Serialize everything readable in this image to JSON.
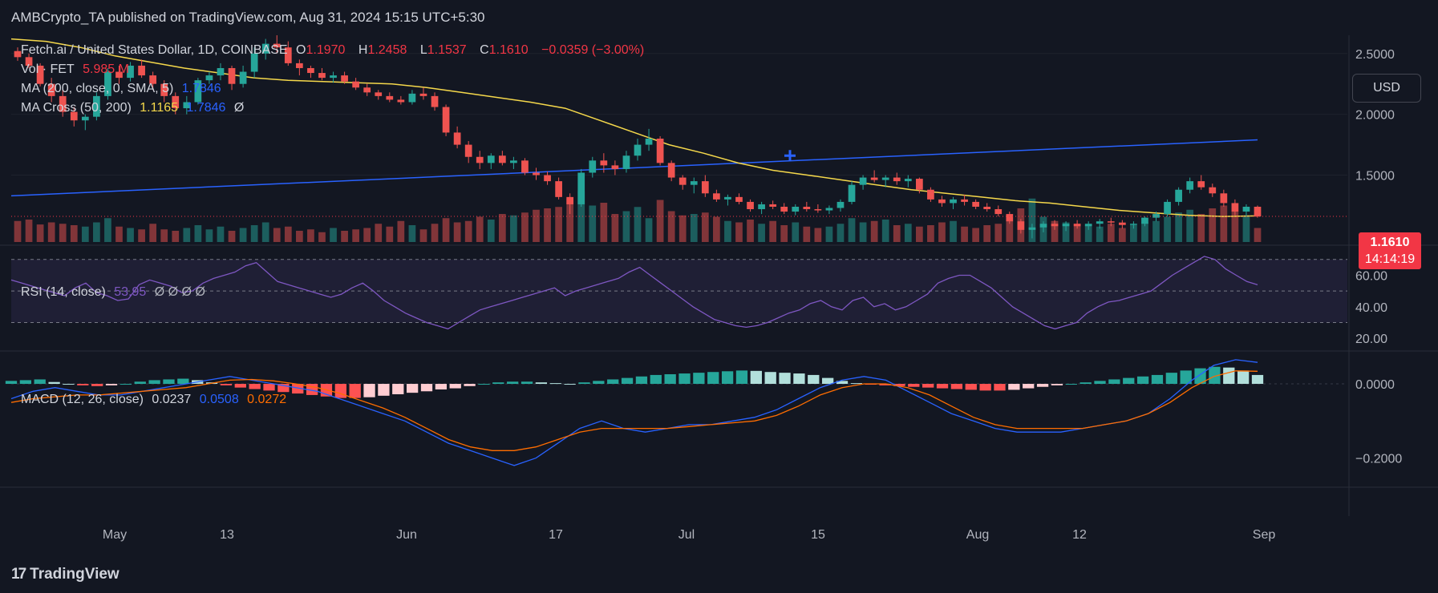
{
  "header": {
    "published": "AMBCrypto_TA published on TradingView.com, Aug 31, 2024 15:15 UTC+5:30"
  },
  "footer": {
    "brand": "TradingView",
    "logo_mark": "17"
  },
  "currency_button": "USD",
  "price_tag": {
    "price": "1.1610",
    "countdown": "14:14:19",
    "color": "#f23645"
  },
  "legend": {
    "symbol": "Fetch.ai / United States Dollar, 1D, COINBASE",
    "open_label": "O",
    "open": "1.1970",
    "high_label": "H",
    "high": "1.2458",
    "low_label": "L",
    "low": "1.1537",
    "close_label": "C",
    "close": "1.1610",
    "change": "−0.0359 (−3.00%)",
    "vol_label": "Vol · FET",
    "vol_value": "5.985 M",
    "ma_label": "MA (200, close, 0, SMA, 5)",
    "ma_value": "1.7846",
    "mac_label": "MA Cross (50, 200)",
    "mac_fast": "1.1165",
    "mac_slow": "1.7846",
    "mac_extra": "Ø",
    "rsi_label": "RSI (14, close)",
    "rsi_value": "53.95",
    "rsi_extra": "Ø Ø Ø Ø",
    "macd_label": "MACD (12, 26, close)",
    "macd_value": "0.0237",
    "signal_value": "0.0508",
    "hist_value": "0.0272"
  },
  "colors": {
    "up": "#26a69a",
    "down": "#ef5350",
    "ma200": "#2962ff",
    "ma50": "#f5d84b",
    "rsi": "#7e57c2",
    "macd": "#2962ff",
    "signal": "#ff6d00",
    "bg": "#131722",
    "text": "#d1d4dc"
  },
  "chart_data": {
    "type": "candlestick",
    "x_ticks": [
      "May",
      "13",
      "Jun",
      "17",
      "Jul",
      "15",
      "Aug",
      "12",
      "Sep"
    ],
    "price_axis": {
      "ticks": [
        "2.5000",
        "2.0000",
        "1.5000"
      ],
      "ylim": [
        0.95,
        2.65
      ]
    },
    "rsi_axis": {
      "ticks": [
        "60.00",
        "40.00",
        "20.00"
      ],
      "ylim": [
        15,
        76
      ],
      "bands": [
        30,
        50,
        70
      ]
    },
    "macd_axis": {
      "ticks": [
        "0.0000",
        "−0.2000"
      ],
      "ylim": [
        -0.27,
        0.08
      ]
    },
    "candles": [
      [
        2.52,
        2.55,
        2.44,
        2.47
      ],
      [
        2.47,
        2.5,
        2.38,
        2.4
      ],
      [
        2.4,
        2.42,
        2.23,
        2.25
      ],
      [
        2.25,
        2.3,
        2.1,
        2.15
      ],
      [
        2.15,
        2.2,
        1.98,
        2.02
      ],
      [
        2.02,
        2.06,
        1.9,
        1.95
      ],
      [
        1.95,
        2.0,
        1.87,
        1.98
      ],
      [
        1.98,
        2.18,
        1.95,
        2.15
      ],
      [
        2.15,
        2.38,
        2.12,
        2.35
      ],
      [
        2.35,
        2.4,
        2.25,
        2.3
      ],
      [
        2.3,
        2.43,
        2.27,
        2.4
      ],
      [
        2.4,
        2.45,
        2.3,
        2.32
      ],
      [
        2.32,
        2.35,
        2.2,
        2.25
      ],
      [
        2.25,
        2.28,
        2.1,
        2.15
      ],
      [
        2.15,
        2.18,
        2.0,
        2.05
      ],
      [
        2.05,
        2.15,
        2.0,
        2.1
      ],
      [
        2.1,
        2.3,
        2.08,
        2.28
      ],
      [
        2.28,
        2.35,
        2.25,
        2.32
      ],
      [
        2.32,
        2.42,
        2.28,
        2.38
      ],
      [
        2.38,
        2.4,
        2.2,
        2.25
      ],
      [
        2.25,
        2.4,
        2.22,
        2.35
      ],
      [
        2.35,
        2.55,
        2.3,
        2.5
      ],
      [
        2.5,
        2.62,
        2.45,
        2.58
      ],
      [
        2.58,
        2.68,
        2.5,
        2.55
      ],
      [
        2.55,
        2.6,
        2.4,
        2.42
      ],
      [
        2.42,
        2.45,
        2.32,
        2.38
      ],
      [
        2.38,
        2.4,
        2.3,
        2.34
      ],
      [
        2.34,
        2.38,
        2.28,
        2.3
      ],
      [
        2.3,
        2.35,
        2.26,
        2.32
      ],
      [
        2.32,
        2.35,
        2.25,
        2.27
      ],
      [
        2.27,
        2.3,
        2.2,
        2.22
      ],
      [
        2.22,
        2.25,
        2.15,
        2.18
      ],
      [
        2.18,
        2.2,
        2.12,
        2.15
      ],
      [
        2.15,
        2.18,
        2.1,
        2.12
      ],
      [
        2.12,
        2.15,
        2.08,
        2.1
      ],
      [
        2.1,
        2.2,
        2.08,
        2.17
      ],
      [
        2.17,
        2.22,
        2.12,
        2.15
      ],
      [
        2.15,
        2.18,
        2.03,
        2.06
      ],
      [
        2.06,
        2.08,
        1.82,
        1.85
      ],
      [
        1.85,
        1.9,
        1.72,
        1.75
      ],
      [
        1.75,
        1.78,
        1.6,
        1.65
      ],
      [
        1.65,
        1.7,
        1.55,
        1.6
      ],
      [
        1.6,
        1.68,
        1.55,
        1.66
      ],
      [
        1.66,
        1.7,
        1.58,
        1.6
      ],
      [
        1.6,
        1.65,
        1.55,
        1.62
      ],
      [
        1.62,
        1.64,
        1.5,
        1.52
      ],
      [
        1.52,
        1.56,
        1.46,
        1.5
      ],
      [
        1.5,
        1.53,
        1.42,
        1.45
      ],
      [
        1.45,
        1.48,
        1.3,
        1.32
      ],
      [
        1.32,
        1.35,
        1.18,
        1.26
      ],
      [
        1.26,
        1.55,
        1.24,
        1.52
      ],
      [
        1.52,
        1.65,
        1.48,
        1.62
      ],
      [
        1.62,
        1.68,
        1.52,
        1.58
      ],
      [
        1.58,
        1.62,
        1.5,
        1.55
      ],
      [
        1.55,
        1.7,
        1.52,
        1.66
      ],
      [
        1.66,
        1.8,
        1.62,
        1.75
      ],
      [
        1.75,
        1.88,
        1.7,
        1.8
      ],
      [
        1.8,
        1.82,
        1.58,
        1.6
      ],
      [
        1.6,
        1.62,
        1.45,
        1.48
      ],
      [
        1.48,
        1.5,
        1.38,
        1.42
      ],
      [
        1.42,
        1.48,
        1.35,
        1.45
      ],
      [
        1.45,
        1.5,
        1.32,
        1.35
      ],
      [
        1.35,
        1.38,
        1.28,
        1.3
      ],
      [
        1.3,
        1.34,
        1.25,
        1.32
      ],
      [
        1.32,
        1.35,
        1.26,
        1.28
      ],
      [
        1.28,
        1.3,
        1.2,
        1.22
      ],
      [
        1.22,
        1.28,
        1.18,
        1.26
      ],
      [
        1.26,
        1.29,
        1.22,
        1.24
      ],
      [
        1.24,
        1.27,
        1.18,
        1.2
      ],
      [
        1.2,
        1.26,
        1.17,
        1.24
      ],
      [
        1.24,
        1.28,
        1.2,
        1.22
      ],
      [
        1.22,
        1.26,
        1.19,
        1.21
      ],
      [
        1.21,
        1.25,
        1.18,
        1.23
      ],
      [
        1.23,
        1.3,
        1.2,
        1.28
      ],
      [
        1.28,
        1.45,
        1.26,
        1.42
      ],
      [
        1.42,
        1.5,
        1.38,
        1.48
      ],
      [
        1.48,
        1.54,
        1.44,
        1.46
      ],
      [
        1.46,
        1.5,
        1.4,
        1.48
      ],
      [
        1.48,
        1.52,
        1.42,
        1.45
      ],
      [
        1.45,
        1.5,
        1.4,
        1.47
      ],
      [
        1.47,
        1.48,
        1.35,
        1.38
      ],
      [
        1.38,
        1.4,
        1.28,
        1.3
      ],
      [
        1.3,
        1.33,
        1.24,
        1.27
      ],
      [
        1.27,
        1.32,
        1.22,
        1.3
      ],
      [
        1.3,
        1.34,
        1.25,
        1.28
      ],
      [
        1.28,
        1.3,
        1.22,
        1.24
      ],
      [
        1.24,
        1.27,
        1.2,
        1.22
      ],
      [
        1.22,
        1.25,
        1.16,
        1.18
      ],
      [
        1.18,
        1.2,
        1.1,
        1.12
      ],
      [
        1.12,
        1.14,
        1.02,
        1.05
      ],
      [
        1.05,
        1.1,
        0.98,
        1.07
      ],
      [
        1.07,
        1.12,
        1.03,
        1.1
      ],
      [
        1.1,
        1.13,
        1.05,
        1.08
      ],
      [
        1.08,
        1.12,
        1.04,
        1.1
      ],
      [
        1.1,
        1.13,
        1.06,
        1.08
      ],
      [
        1.08,
        1.12,
        1.05,
        1.1
      ],
      [
        1.1,
        1.14,
        1.06,
        1.12
      ],
      [
        1.12,
        1.15,
        1.08,
        1.11
      ],
      [
        1.11,
        1.13,
        1.06,
        1.09
      ],
      [
        1.09,
        1.12,
        1.06,
        1.1
      ],
      [
        1.1,
        1.16,
        1.08,
        1.15
      ],
      [
        1.15,
        1.2,
        1.12,
        1.18
      ],
      [
        1.18,
        1.3,
        1.16,
        1.28
      ],
      [
        1.28,
        1.4,
        1.25,
        1.38
      ],
      [
        1.38,
        1.48,
        1.35,
        1.45
      ],
      [
        1.45,
        1.5,
        1.38,
        1.4
      ],
      [
        1.4,
        1.43,
        1.32,
        1.35
      ],
      [
        1.35,
        1.38,
        1.24,
        1.27
      ],
      [
        1.27,
        1.3,
        1.17,
        1.2
      ],
      [
        1.2,
        1.26,
        1.16,
        1.24
      ],
      [
        1.24,
        1.25,
        1.15,
        1.16
      ]
    ],
    "volume": [
      30,
      32,
      25,
      28,
      26,
      24,
      22,
      28,
      34,
      22,
      20,
      18,
      26,
      18,
      16,
      20,
      24,
      18,
      22,
      16,
      20,
      24,
      28,
      20,
      22,
      16,
      18,
      14,
      20,
      16,
      18,
      20,
      26,
      22,
      30,
      24,
      18,
      26,
      34,
      28,
      30,
      36,
      32,
      40,
      38,
      42,
      46,
      48,
      50,
      62,
      72,
      52,
      56,
      40,
      44,
      50,
      34,
      60,
      44,
      38,
      40,
      42,
      36,
      30,
      28,
      32,
      26,
      30,
      24,
      28,
      22,
      20,
      22,
      26,
      34,
      28,
      30,
      32,
      24,
      26,
      22,
      24,
      28,
      30,
      22,
      20,
      24,
      26,
      30,
      48,
      62,
      36,
      30,
      28,
      26,
      24,
      22,
      26,
      20,
      24,
      28,
      30,
      36,
      42,
      46,
      40,
      48,
      52,
      44,
      38,
      20
    ],
    "ma200": [
      1.33,
      1.79
    ],
    "ma50": [
      2.62,
      2.6,
      2.55,
      2.48,
      2.43,
      2.38,
      2.34,
      2.3,
      2.28,
      2.27,
      2.26,
      2.25,
      2.22,
      2.18,
      2.14,
      2.1,
      2.05,
      1.95,
      1.85,
      1.75,
      1.68,
      1.6,
      1.54,
      1.5,
      1.46,
      1.42,
      1.38,
      1.35,
      1.32,
      1.29,
      1.27,
      1.24,
      1.21,
      1.19,
      1.17,
      1.16,
      1.165
    ],
    "rsi": [
      57,
      55,
      53,
      51,
      49,
      47,
      52,
      55,
      49,
      47,
      44,
      45,
      54,
      57,
      55,
      53,
      49,
      50,
      55,
      58,
      60,
      62,
      66,
      68,
      62,
      56,
      54,
      52,
      50,
      48,
      46,
      48,
      52,
      55,
      50,
      44,
      40,
      36,
      33,
      30,
      28,
      26,
      30,
      34,
      38,
      40,
      42,
      44,
      46,
      48,
      50,
      52,
      47,
      50,
      52,
      54,
      56,
      58,
      62,
      65,
      60,
      55,
      50,
      45,
      40,
      36,
      32,
      30,
      28,
      27,
      28,
      30,
      33,
      36,
      38,
      42,
      44,
      40,
      38,
      44,
      46,
      40,
      42,
      38,
      40,
      44,
      48,
      55,
      58,
      60,
      60,
      56,
      52,
      46,
      40,
      36,
      32,
      28,
      26,
      28,
      30,
      36,
      40,
      43,
      44,
      46,
      48,
      50,
      55,
      60,
      64,
      68,
      72,
      70,
      64,
      60,
      56,
      53.95
    ],
    "macd": [
      -0.04,
      -0.02,
      -0.01,
      -0.02,
      -0.03,
      -0.03,
      -0.02,
      -0.01,
      0.0,
      0.01,
      0.02,
      0.01,
      0.0,
      -0.01,
      -0.02,
      -0.04,
      -0.06,
      -0.08,
      -0.1,
      -0.13,
      -0.16,
      -0.18,
      -0.2,
      -0.22,
      -0.2,
      -0.16,
      -0.12,
      -0.1,
      -0.12,
      -0.13,
      -0.12,
      -0.11,
      -0.11,
      -0.1,
      -0.09,
      -0.07,
      -0.04,
      -0.01,
      0.01,
      0.02,
      0.01,
      -0.02,
      -0.05,
      -0.08,
      -0.1,
      -0.12,
      -0.13,
      -0.13,
      -0.13,
      -0.12,
      -0.11,
      -0.1,
      -0.08,
      -0.04,
      0.01,
      0.05,
      0.065,
      0.058
    ],
    "signal": [
      -0.05,
      -0.04,
      -0.035,
      -0.03,
      -0.03,
      -0.025,
      -0.02,
      -0.015,
      -0.01,
      0.0,
      0.01,
      0.012,
      0.008,
      0.0,
      -0.01,
      -0.025,
      -0.045,
      -0.065,
      -0.09,
      -0.12,
      -0.15,
      -0.17,
      -0.18,
      -0.18,
      -0.17,
      -0.15,
      -0.13,
      -0.12,
      -0.12,
      -0.12,
      -0.12,
      -0.115,
      -0.11,
      -0.105,
      -0.1,
      -0.085,
      -0.06,
      -0.03,
      -0.01,
      0.0,
      0.0,
      -0.01,
      -0.03,
      -0.06,
      -0.09,
      -0.11,
      -0.12,
      -0.12,
      -0.12,
      -0.12,
      -0.11,
      -0.1,
      -0.08,
      -0.05,
      -0.01,
      0.02,
      0.035,
      0.034
    ],
    "hist": [
      0.008,
      0.01,
      0.012,
      0.005,
      0.0,
      -0.004,
      -0.006,
      -0.004,
      0.0,
      0.006,
      0.01,
      0.012,
      0.014,
      0.01,
      0.004,
      -0.004,
      -0.01,
      -0.014,
      -0.018,
      -0.022,
      -0.026,
      -0.03,
      -0.034,
      -0.038,
      -0.038,
      -0.036,
      -0.032,
      -0.028,
      -0.024,
      -0.02,
      -0.015,
      -0.012,
      -0.006,
      0.0,
      0.004,
      0.006,
      0.006,
      0.004,
      0.002,
      0.0,
      0.004,
      0.008,
      0.012,
      0.016,
      0.02,
      0.024,
      0.026,
      0.028,
      0.03,
      0.032,
      0.034,
      0.036,
      0.035,
      0.032,
      0.03,
      0.028,
      0.024,
      0.016,
      0.008,
      0.002,
      -0.002,
      -0.004,
      -0.006,
      -0.008,
      -0.01,
      -0.012,
      -0.014,
      -0.016,
      -0.018,
      -0.018,
      -0.016,
      -0.012,
      -0.008,
      -0.004,
      0.0,
      0.004,
      0.008,
      0.012,
      0.016,
      0.02,
      0.024,
      0.03,
      0.036,
      0.042,
      0.046,
      0.044,
      0.036,
      0.024
    ]
  }
}
